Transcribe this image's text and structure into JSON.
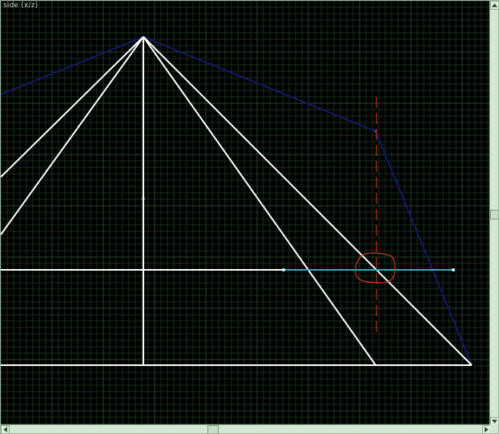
{
  "viewport": {
    "title": "side (x/z)",
    "background": "#000000"
  },
  "colors": {
    "grid_minor": "#17301d",
    "grid_major": "#24452b",
    "white_lines": "#ffffff",
    "blue_path": "#141a66",
    "cyan_line": "#1fb5c4",
    "red_dashed": "#c8321e",
    "red_circle": "#d23c22",
    "scrollbar": "#d4e6d4"
  },
  "icons": {
    "up": "arrow-up-icon",
    "down": "arrow-down-icon",
    "left": "arrow-left-icon",
    "right": "arrow-right-icon"
  }
}
